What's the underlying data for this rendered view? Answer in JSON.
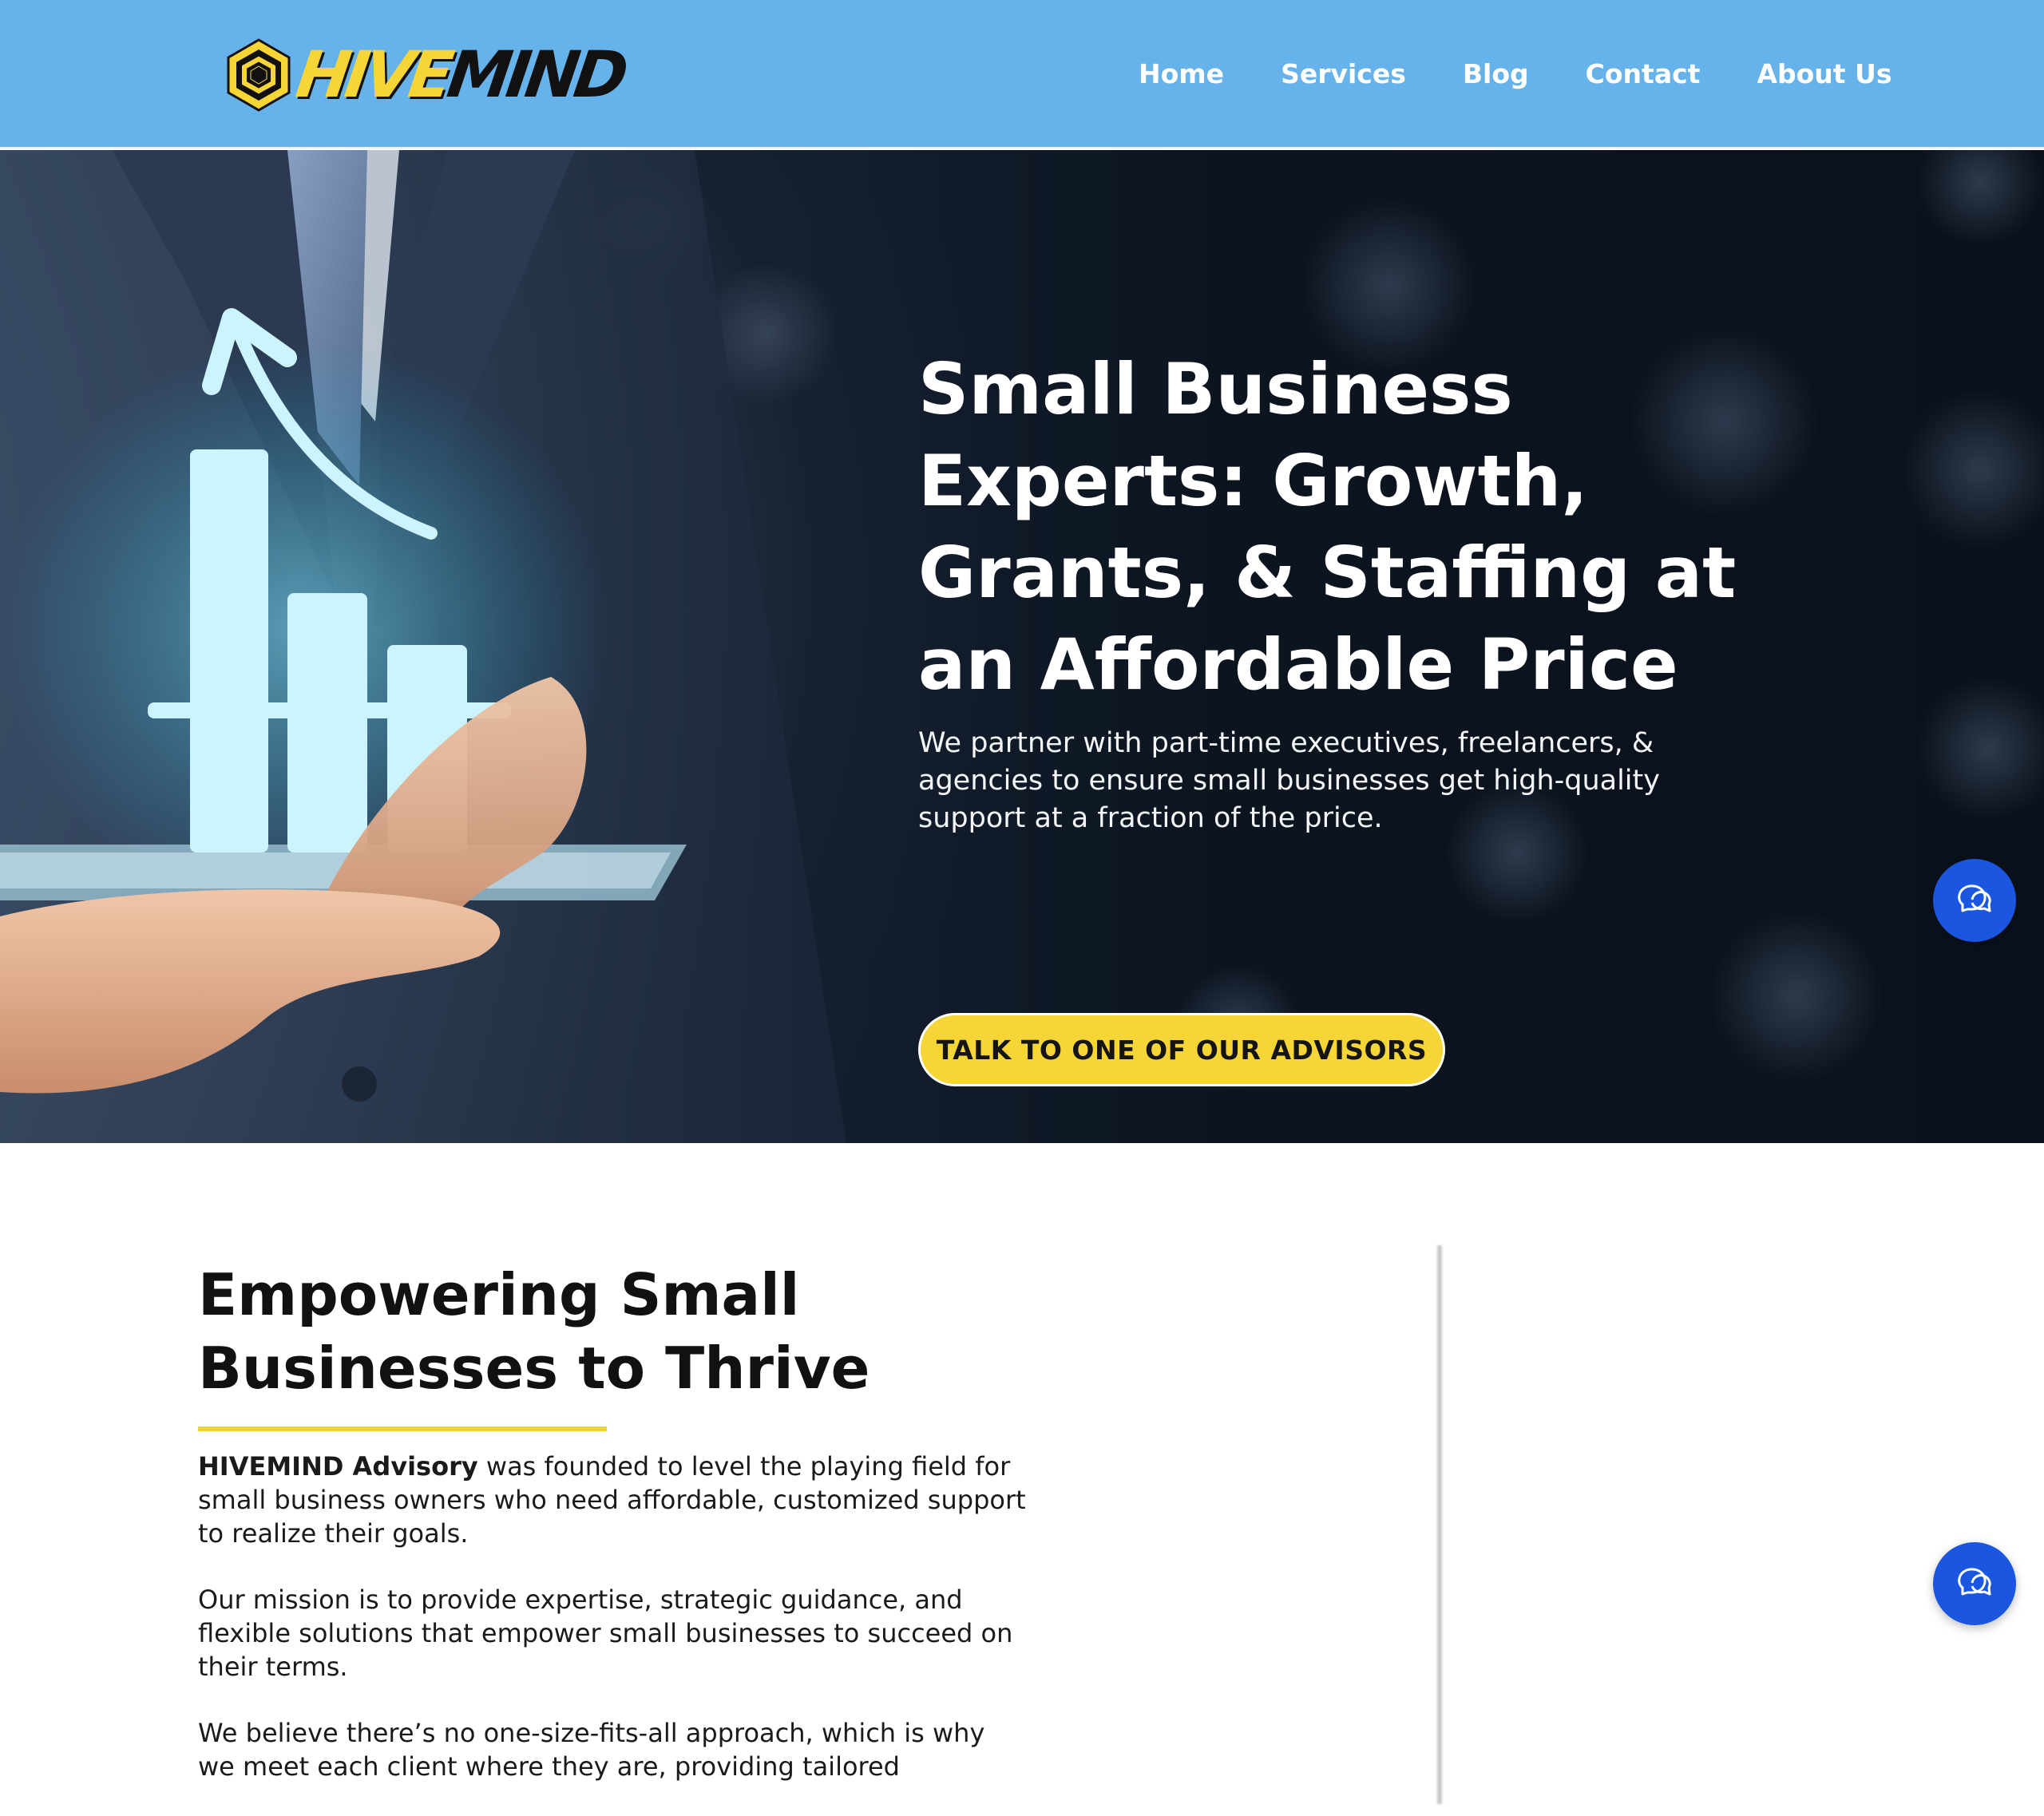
{
  "brand": {
    "name_part1": "HIVE",
    "name_part2": "MIND",
    "colors": {
      "nav_bg": "#66b2ea",
      "accent_yellow": "#f6d537",
      "chat_blue": "#1a56e0"
    }
  },
  "nav": {
    "items": [
      {
        "label": "Home"
      },
      {
        "label": "Services"
      },
      {
        "label": "Blog"
      },
      {
        "label": "Contact"
      },
      {
        "label": "About Us"
      }
    ]
  },
  "hero": {
    "title": "Small Business Experts: Growth, Grants, & Staffing at an Affordable Price",
    "subtitle": "We partner with part-time executives, freelancers, & agencies to ensure small businesses get high-quality support at a fraction of the price.",
    "cta_label": "TALK TO ONE OF OUR ADVISORS"
  },
  "about": {
    "title": "Empowering Small Businesses to Thrive",
    "p1_bold": "HIVEMIND Advisory",
    "p1_rest": " was founded to level the playing field for small business owners who need affordable, customized support to realize their goals.",
    "p2": "Our mission is to provide expertise, strategic guidance, and flexible solutions that empower small businesses to succeed on their terms.",
    "p3": "We believe there’s no one-size-fits-all approach, which is why we meet each client where they are, providing tailored"
  },
  "chat": {
    "icon": "chat-bubble-icon"
  }
}
